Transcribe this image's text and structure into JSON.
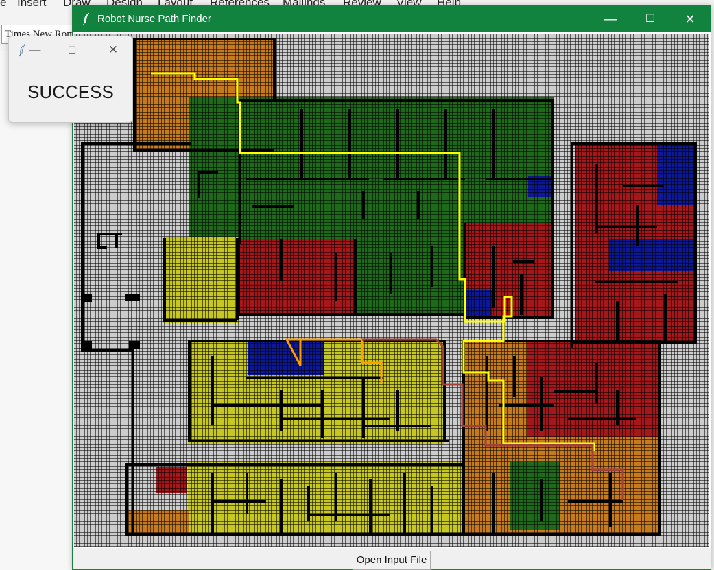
{
  "background_app": {
    "menu": [
      "e",
      "Insert",
      "Draw",
      "Design",
      "Layout",
      "References",
      "Mailings",
      "Review",
      "View",
      "Help"
    ],
    "font_name": "Times New Roman"
  },
  "main_window": {
    "title": "Robot Nurse Path Finder",
    "icon": "feather-icon",
    "controls": {
      "minimize": "—",
      "maximize": "☐",
      "close": "✕"
    },
    "open_button": "Open Input File",
    "colors": {
      "titlebar": "#12833f",
      "wall": "#000000",
      "corridor": "#cccccc",
      "orange": "#c77a1c",
      "green": "#1f6a1a",
      "red": "#a4171a",
      "blue": "#0d1897",
      "yellow": "#c7c721",
      "path_yellow": "#ffff00",
      "path_orange": "#ff9f00",
      "path_brown": "#a0403a"
    }
  },
  "popup": {
    "controls": {
      "minimize": "—",
      "maximize": "☐",
      "close": "✕"
    },
    "message": "SUCCESS"
  }
}
